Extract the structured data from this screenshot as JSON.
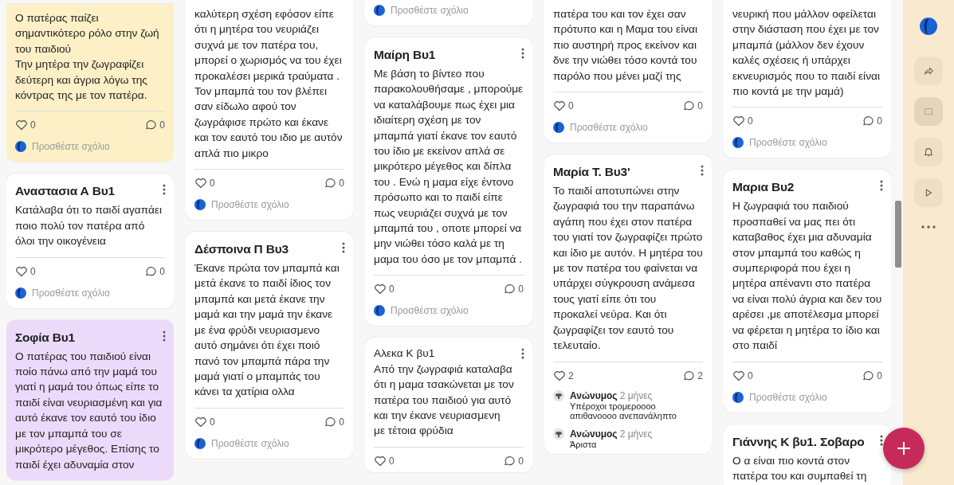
{
  "columns": [
    {
      "cards": [
        {
          "color": "#fdf0c6",
          "body": "Ο πατέρας παίζει σημαντικότερο ρόλο στην ζωή του παιδιού\nΤην μητέρα την ζωγραφίζει δεύτερη και άγρια λόγω της κόντρας της με τον πατέρα.",
          "likes": "0",
          "comment_count": "0",
          "add_comment": "Προσθέστε σχόλιο"
        },
        {
          "color": "#ffffff",
          "title": "Αναστασια Α Βυ1",
          "body": "Κατάλαβα ότι το παιδί αγαπάει ποιο πολύ τον πατέρα από όλοι την οικογένεια",
          "likes": "0",
          "comment_count": "0",
          "add_comment": "Προσθέστε σχόλιο"
        },
        {
          "color": "#ecdafb",
          "title": "Σοφία Βυ1",
          "body": "Ο πατέρας του παιδιού είναι ποίο πάνω από την μαμά του γιατί η μαμά του όπως είπε το παιδί είναι νευριασμένη και για αυτό έκανε τον εαυτό του ίδιο με τον μπαμπά του σε μικρότερο μέγεθος. Επίσης το παιδί έχει αδυναμία στον"
        }
      ]
    },
    {
      "cards": [
        {
          "color": "#ffffff",
          "body": "καλύτερη σχέση εφόσον είπε ότι η μητέρα του νευριάζει συχνά με τον πατέρα του, μπορεί ο χωρισμός να του έχει προκαλέσει μερικά τραύματα . Τον μπαμπά του τον βλέπει σαν είδωλο αφού τον ζωγράφισε πρώτο και έκανε και τον εαυτό του ιδιο με αυτόν απλά πιο μικρο",
          "likes": "0",
          "comment_count": "0",
          "add_comment": "Προσθέστε σχόλιο"
        },
        {
          "color": "#ffffff",
          "title": "Δέσποινα Π Βυ3",
          "body": "Έκανε πρώτα τον μπαμπά και μετά έκανε το παιδί ίδιος τον μπαμπά και μετά έκανε την μαμά και την μαμά την έκανε με ένα φρύδι νευριασμενο αυτό σημάνει ότι έχει ποιό πανό τον μπαμπά πάρα την μαμά γιατί ο μπαμπάς του κάνει τα χατίρια ολλα",
          "likes": "0",
          "comment_count": "0",
          "add_comment": "Προσθέστε σχόλιο"
        }
      ]
    },
    {
      "cards": [
        {
          "color": "#ffffff",
          "add_comment": "Προσθέστε σχόλιο"
        },
        {
          "color": "#ffffff",
          "title": "Μαίρη Βυ1",
          "body": "Με βάση το βίντεο που παρακολουθήσαμε , μπορούμε να καταλάβουμε πως έχει μια ιδιαίτερη σχέση με τον μπαμπά γιατί έκανε τον εαυτό του ίδιο με εκείνον απλά σε μικρότερο μέγεθος και δίπλα του . Ενώ η μαμα είχε έντονο πρόσωπο και το παιδί είπε πως νευριάζει συχνά με τον μπαμπά του , οποτε μπορεί να μην νιώθει τόσο καλά με τη μαμα του όσο με τον μπαμπά .",
          "likes": "0",
          "comment_count": "0",
          "add_comment": "Προσθέστε σχόλιο"
        },
        {
          "color": "#ffffff",
          "body": "Αλεκα Κ βυ1\nΑπό την ζωγραφιά καταλαβα ότι η μαμα τσακώνεται με τον πατέρα του παιδιού για αυτό και την έκανε νευριασμενη με τέτοια φρύδια",
          "likes": "0",
          "comment_count": "0"
        }
      ]
    },
    {
      "cards": [
        {
          "color": "#ffffff",
          "body": "πατέρα του και τον έχει σαν πρότυπο και η Μαμα του είναι πιο αυστηρή προς εκείνον και δνε την νιώθει τόσο κοντά του παρόλο που μένει μαζί της",
          "likes": "0",
          "comment_count": "0",
          "add_comment": "Προσθέστε σχόλιο"
        },
        {
          "color": "#ffffff",
          "title": "Μαρία Τ. Βυ3'",
          "body": "Το παιδί αποτυπώνει στην ζωγραφιά του την παραπάνω αγάπη που έχει στον πατέρα του γιατί τον ζωγραφίζει πρώτο και ίδιο με αυτόν. Η μητέρα του με τον πατέρα του φαίνεται να υπάρχει σύγκρουση ανάμεσα τους γιατί είπε ότι του προκαλεί νεύρα. Και ότι ζωγραφίζει τον εαυτό του τελευταίο.",
          "likes": "2",
          "comment_count": "2",
          "comments": [
            {
              "author": "Ανώνυμος",
              "time": "2 μήνες",
              "text": "Υπέροχοι τρομεροοοο απιθανοοοο ανεπανάληπτο"
            },
            {
              "author": "Ανώνυμος",
              "time": "2 μήνες",
              "text": "Άριστα"
            }
          ]
        }
      ]
    },
    {
      "cards": [
        {
          "color": "#ffffff",
          "body": "νευρική που μάλλον οφείλεται στην διάσταση που έχει με τον μπαμπά (μάλλον δεν έχουν καλές σχέσεις ή υπάρχει εκνευρισμός που το παιδί είναι πιο κοντά με την μαμά)",
          "likes": "0",
          "comment_count": "0",
          "add_comment": "Προσθέστε σχόλιο"
        },
        {
          "color": "#ffffff",
          "title": "Μαρια Βυ2",
          "body": "Η  ζωγραφιά του παιδιού προσπαθεί να μας πει ότι καταβαθος έχει μια αδυναμία στον μπαμπά του καθώς η συμπεριφορά που έχει η μητέρα απέναντι στο πατέρα να είναι πολύ άγρια και δεν του αρέσει ,με αποτέλεσμα μπορεί να φέρεται η μητέρα το ίδιο και στο παιδί",
          "likes": "0",
          "comment_count": "0",
          "add_comment": "Προσθέστε σχόλιο"
        },
        {
          "color": "#ffffff",
          "title": "Γιάννης Κ βυ1. Σοβαρο",
          "body": "Ο α είναι πιο κοντά στον πατέρα του και συμπαθεί τη"
        }
      ]
    }
  ]
}
